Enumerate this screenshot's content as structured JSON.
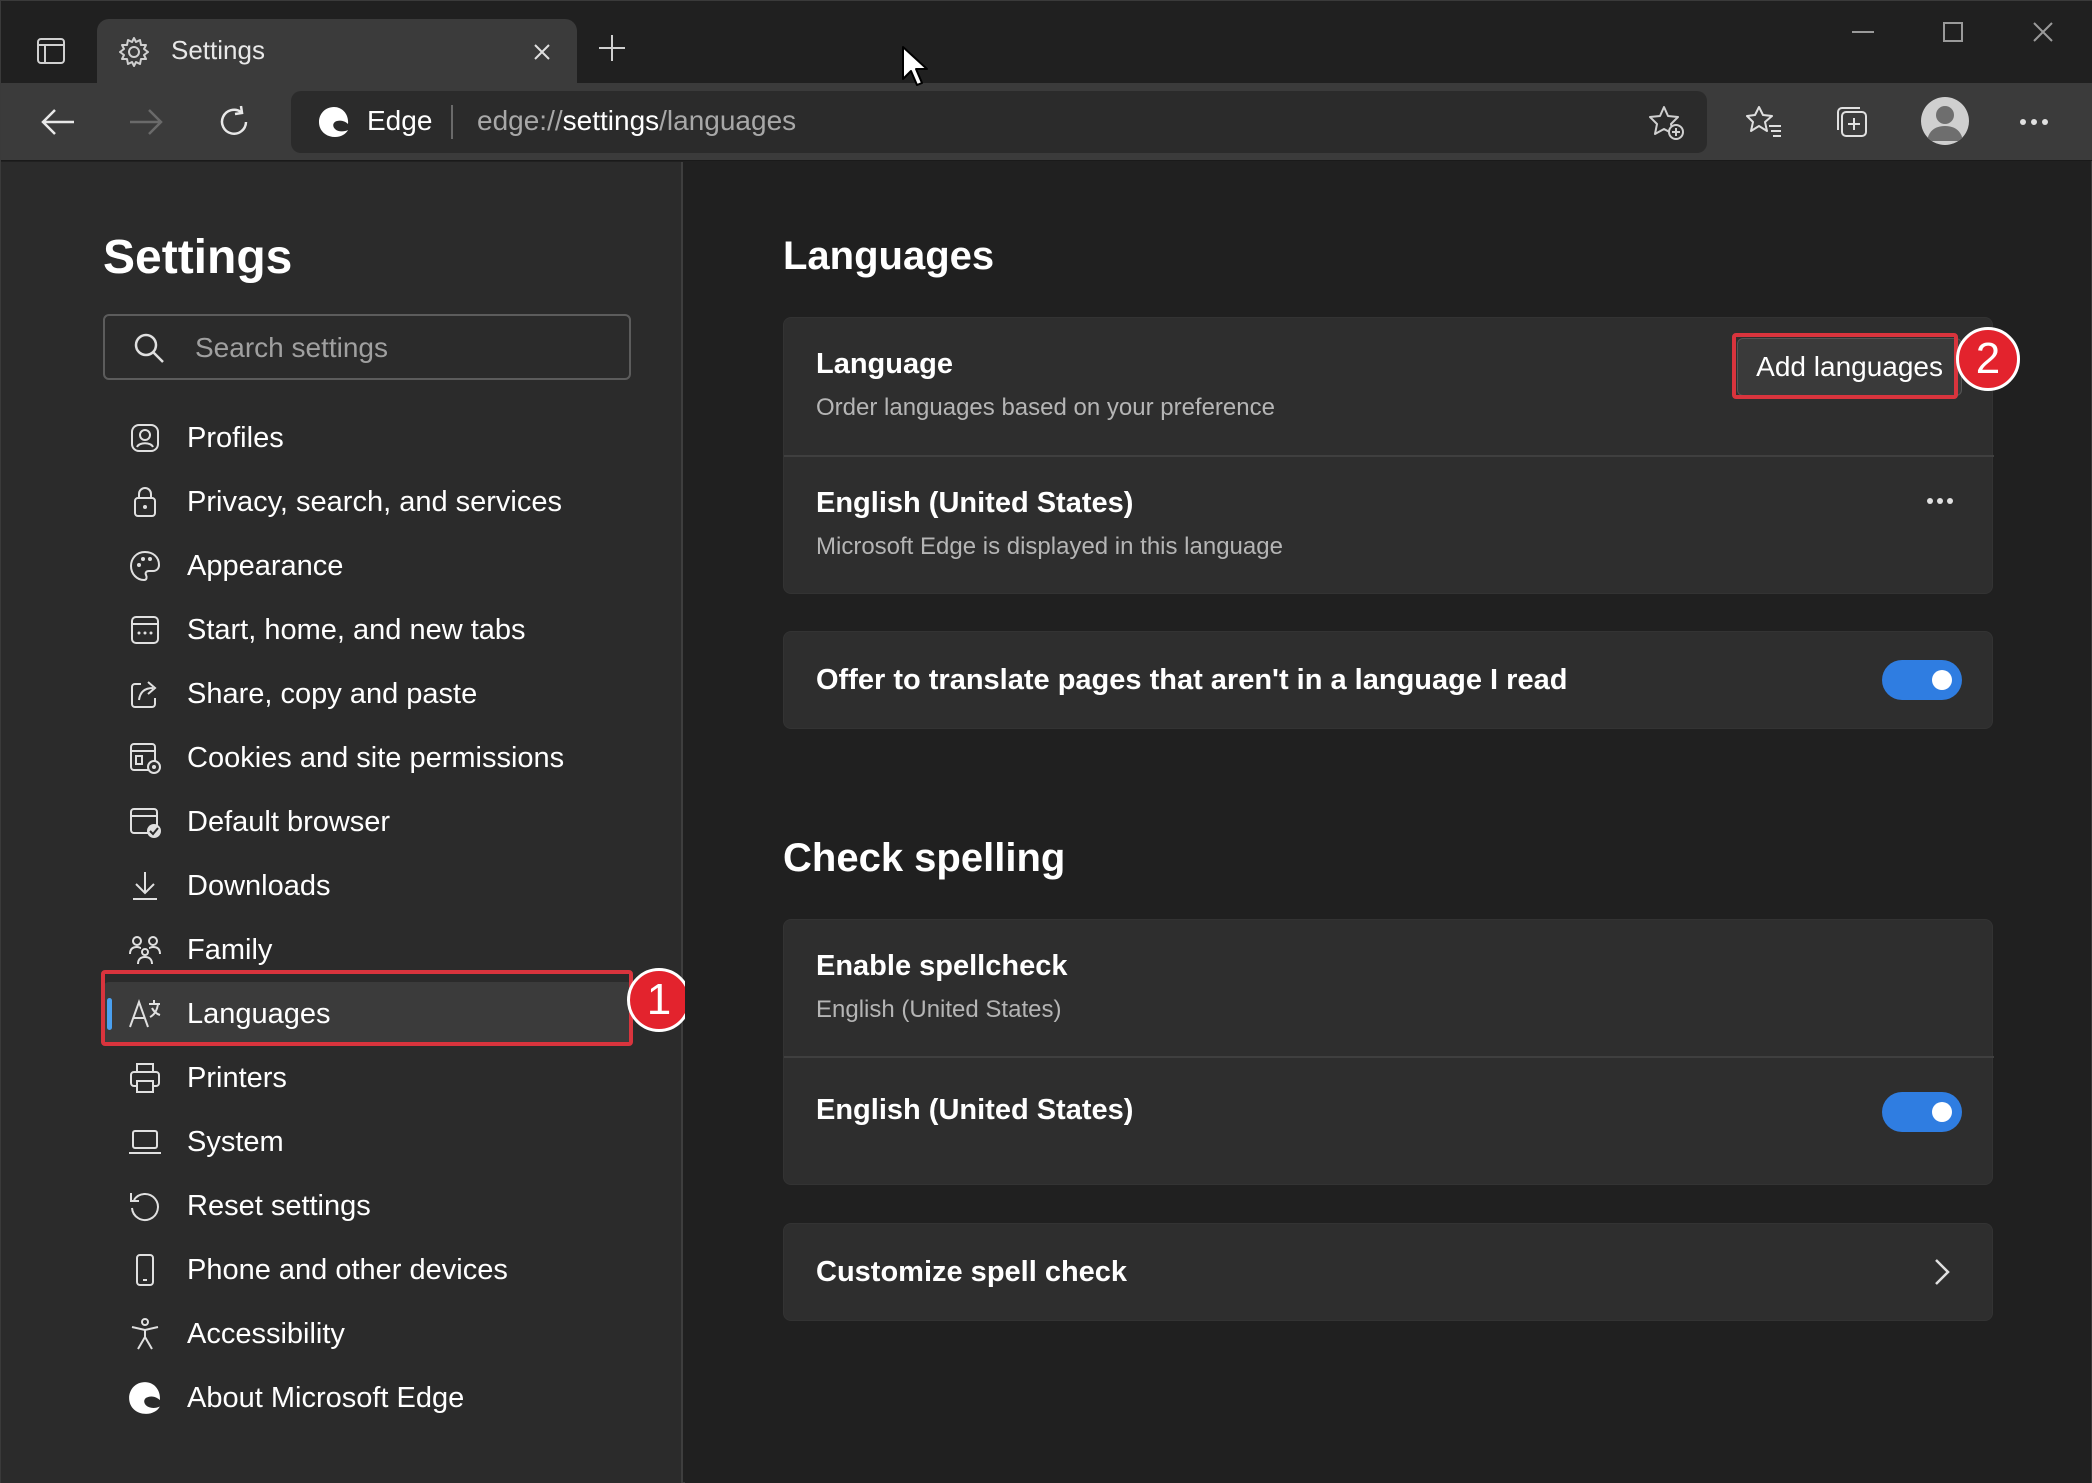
{
  "browser": {
    "tab": {
      "title": "Settings"
    },
    "omnibox": {
      "site_name": "Edge",
      "url_prefix": "edge://",
      "url_bold": "settings",
      "url_suffix": "/languages"
    }
  },
  "sidebar": {
    "title": "Settings",
    "search_placeholder": "Search settings",
    "items": [
      {
        "label": "Profiles",
        "icon": "profile-icon"
      },
      {
        "label": "Privacy, search, and services",
        "icon": "lock-icon"
      },
      {
        "label": "Appearance",
        "icon": "palette-icon"
      },
      {
        "label": "Start, home, and new tabs",
        "icon": "start-page-icon"
      },
      {
        "label": "Share, copy and paste",
        "icon": "share-icon"
      },
      {
        "label": "Cookies and site permissions",
        "icon": "cookies-icon"
      },
      {
        "label": "Default browser",
        "icon": "default-browser-icon"
      },
      {
        "label": "Downloads",
        "icon": "download-icon"
      },
      {
        "label": "Family",
        "icon": "family-icon"
      },
      {
        "label": "Languages",
        "icon": "languages-icon",
        "active": true
      },
      {
        "label": "Printers",
        "icon": "printer-icon"
      },
      {
        "label": "System",
        "icon": "laptop-icon"
      },
      {
        "label": "Reset settings",
        "icon": "reset-icon"
      },
      {
        "label": "Phone and other devices",
        "icon": "phone-icon"
      },
      {
        "label": "Accessibility",
        "icon": "accessibility-icon"
      },
      {
        "label": "About Microsoft Edge",
        "icon": "edge-logo-icon"
      }
    ]
  },
  "main": {
    "languages_section": {
      "title": "Languages",
      "language_row": {
        "title": "Language",
        "subtitle": "Order languages based on your preference",
        "button": "Add languages"
      },
      "english_row": {
        "title": "English (United States)",
        "subtitle": "Microsoft Edge is displayed in this language"
      },
      "translate_row": {
        "title": "Offer to translate pages that aren't in a language I read",
        "toggle_on": true
      }
    },
    "spelling_section": {
      "title": "Check spelling",
      "enable_row": {
        "title": "Enable spellcheck",
        "subtitle": "English (United States)"
      },
      "english_row": {
        "title": "English (United States)",
        "toggle_on": true
      },
      "customize_row": {
        "title": "Customize spell check"
      }
    }
  },
  "annotations": {
    "callout_1": "1",
    "callout_2": "2"
  },
  "colors": {
    "accent": "#2f7de1",
    "highlight": "#d9343d",
    "background": "#202020",
    "card": "#2e2e2e"
  }
}
